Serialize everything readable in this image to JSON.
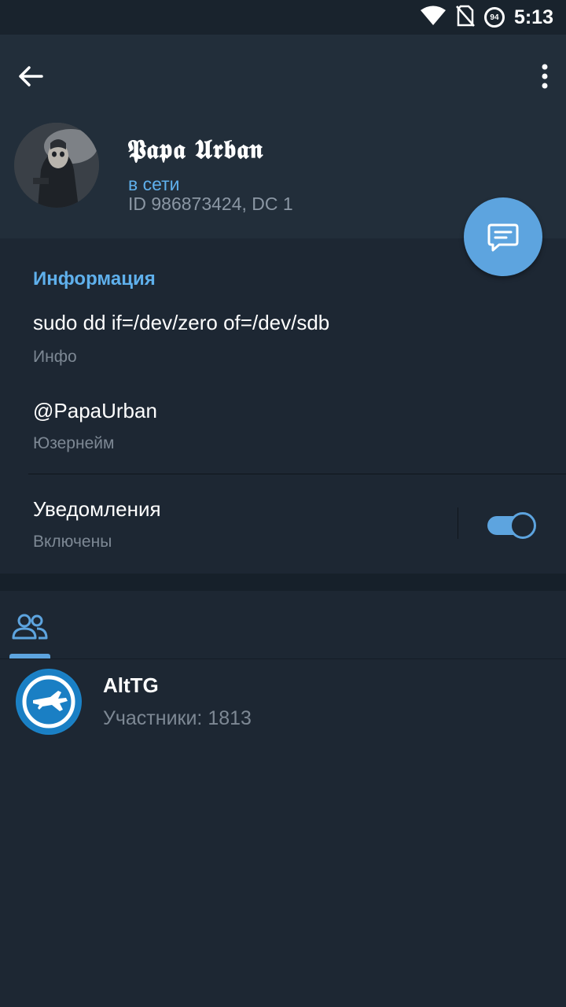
{
  "status_bar": {
    "time": "5:13",
    "battery_level": "94",
    "icons": [
      "wifi-icon",
      "no-sim-icon",
      "battery-icon"
    ]
  },
  "toolbar": {
    "back_icon": "arrow-left-icon",
    "menu_icon": "more-vertical-icon"
  },
  "profile": {
    "name": "𝕻𝖆𝖕𝖆 𝖀𝖗𝖇𝖆𝖓",
    "status": "в сети",
    "id_line": "ID 986873424, DC 1"
  },
  "fab": {
    "icon": "message-icon"
  },
  "info": {
    "title": "Информация",
    "bio": "sudo dd if=/dev/zero of=/dev/sdb",
    "bio_label": "Инфо",
    "username": "@PapaUrban",
    "username_label": "Юзернейм",
    "notifications": "Уведомления",
    "notifications_state": "Включены",
    "notifications_enabled": true
  },
  "tabs": {
    "groups_icon": "users-icon"
  },
  "groups": [
    {
      "name": "AltTG",
      "members": "Участники: 1813"
    }
  ],
  "colors": {
    "accent": "#5da4df",
    "link": "#5fb0ec",
    "background": "#1d2733",
    "header": "#222e3a"
  }
}
